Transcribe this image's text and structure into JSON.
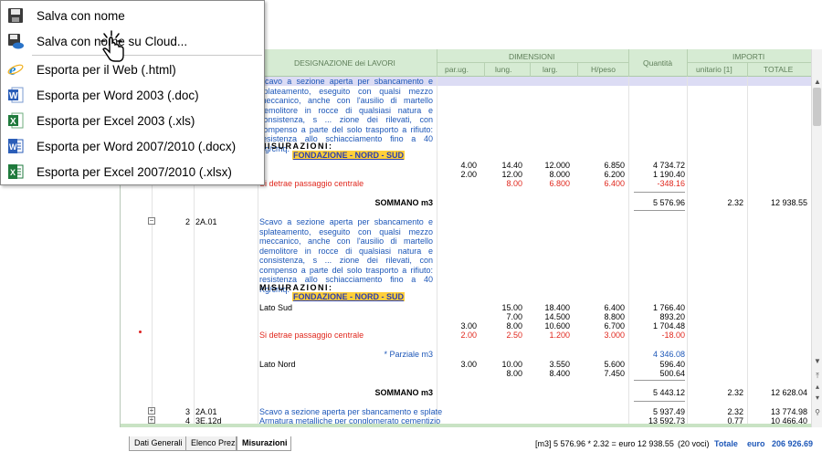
{
  "menu": {
    "items": [
      {
        "label": "Salva con nome",
        "icon": "floppy-save-icon"
      },
      {
        "label": "Salva con nome su Cloud...",
        "icon": "cloud-save-icon"
      },
      {
        "label": "Esporta per il Web (.html)",
        "icon": "ie-web-icon"
      },
      {
        "label": "Esporta per Word 2003 (.doc)",
        "icon": "word-2003-icon"
      },
      {
        "label": "Esporta per Excel 2003 (.xls)",
        "icon": "excel-2003-icon"
      },
      {
        "label": "Esporta per Word 2007/2010 (.docx)",
        "icon": "word-2007-icon"
      },
      {
        "label": "Esporta per Excel 2007/2010 (.xlsx)",
        "icon": "excel-2007-icon"
      }
    ]
  },
  "header": {
    "designazione": "DESIGNAZIONE dei LAVORI",
    "dimensioni": "DIMENSIONI",
    "par_ug": "par.ug.",
    "lung": "lung.",
    "larg": "larg.",
    "h_peso": "H/peso",
    "quantita": "Quantità",
    "importi": "IMPORTI",
    "unitario": "unitario [1]",
    "totale": "TOTALE"
  },
  "item1": {
    "desc": "Scavo a sezione aperta per sbancamento e splateamento, eseguito con qualsi mezzo meccanico, anche con l'ausilio di martello demolitore in rocce di qualsiasi natura e consistenza, s ... zione dei rilevati, con compenso a parte del solo trasporto a rifiuto: resistenza allo schiacciamento fino a 40 Kg/cmq.",
    "misurazioni": "MISURAZIONI:",
    "group": "FONDAZIONE - NORD - SUD",
    "rows": [
      {
        "par": "4.00",
        "lung": "14.40",
        "larg": "12.000",
        "h": "6.850",
        "q": "4 734.72"
      },
      {
        "par": "2.00",
        "lung": "12.00",
        "larg": "8.000",
        "h": "6.200",
        "q": "1 190.40"
      }
    ],
    "detrae": {
      "label": "Si detrae passaggio centrale",
      "lung": "8.00",
      "larg": "6.800",
      "h": "6.400",
      "q": "-348.16"
    },
    "sommano": "SOMMANO m3",
    "sommano_q": "5 576.96",
    "unitario": "2.32",
    "totale": "12 938.55"
  },
  "item2": {
    "num": "2",
    "code": "2A.01",
    "desc": "Scavo a sezione aperta per sbancamento e splateamento, eseguito con qualsi mezzo meccanico, anche con l'ausilio di martello demolitore in rocce di qualsiasi natura e consistenza, s ... zione dei rilevati, con compenso a parte del solo trasporto a rifiuto: resistenza allo schiacciamento fino a 40 Kg/cmq.",
    "misurazioni": "MISURAZIONI:",
    "group": "FONDAZIONE - NORD - SUD",
    "lato_sud": "Lato Sud",
    "sud_rows": [
      {
        "par": "",
        "lung": "15.00",
        "larg": "18.400",
        "h": "6.400",
        "q": "1 766.40"
      },
      {
        "par": "",
        "lung": "7.00",
        "larg": "14.500",
        "h": "8.800",
        "q": "893.20"
      },
      {
        "par": "3.00",
        "lung": "8.00",
        "larg": "10.600",
        "h": "6.700",
        "q": "1 704.48"
      }
    ],
    "detrae": {
      "label": "Si detrae passaggio centrale",
      "par": "2.00",
      "lung": "2.50",
      "larg": "1.200",
      "h": "3.000",
      "q": "-18.00"
    },
    "parziale_label": "* Parziale m3",
    "parziale_q": "4 346.08",
    "lato_nord": "Lato Nord",
    "nord_rows": [
      {
        "par": "3.00",
        "lung": "10.00",
        "larg": "3.550",
        "h": "5.600",
        "q": "596.40"
      },
      {
        "par": "",
        "lung": "8.00",
        "larg": "8.400",
        "h": "7.450",
        "q": "500.64"
      }
    ],
    "sommano": "SOMMANO m3",
    "sommano_q": "5 443.12",
    "unitario": "2.32",
    "totale": "12 628.04"
  },
  "item3": {
    "num": "3",
    "code": "2A.01",
    "desc": "Scavo a sezione aperta per sbancamento e splate",
    "q": "5 937.49",
    "unitario": "2.32",
    "totale": "13 774.98"
  },
  "item4": {
    "num": "4",
    "code": "3E.12d",
    "desc": "Armatura metalliche per conglomerato cementizio",
    "q": "13 592.73",
    "unitario": "0.77",
    "totale": "10 466.40"
  },
  "tabs": [
    {
      "label": "Dati Generali"
    },
    {
      "label": "Elenco Prezzi"
    },
    {
      "label": "Misurazioni"
    }
  ],
  "status": {
    "formula": "[m3] 5 576.96 * 2.32 = euro 12 938.55",
    "voci": "(20 voci)",
    "totale_label": "Totale",
    "currency": "euro",
    "totale_value": "206 926.69"
  },
  "colors": {
    "header_bg": "#d6ebd3",
    "blue_text": "#1d57b8",
    "red_text": "#e0281e",
    "highlight": "#ffcf3a"
  }
}
